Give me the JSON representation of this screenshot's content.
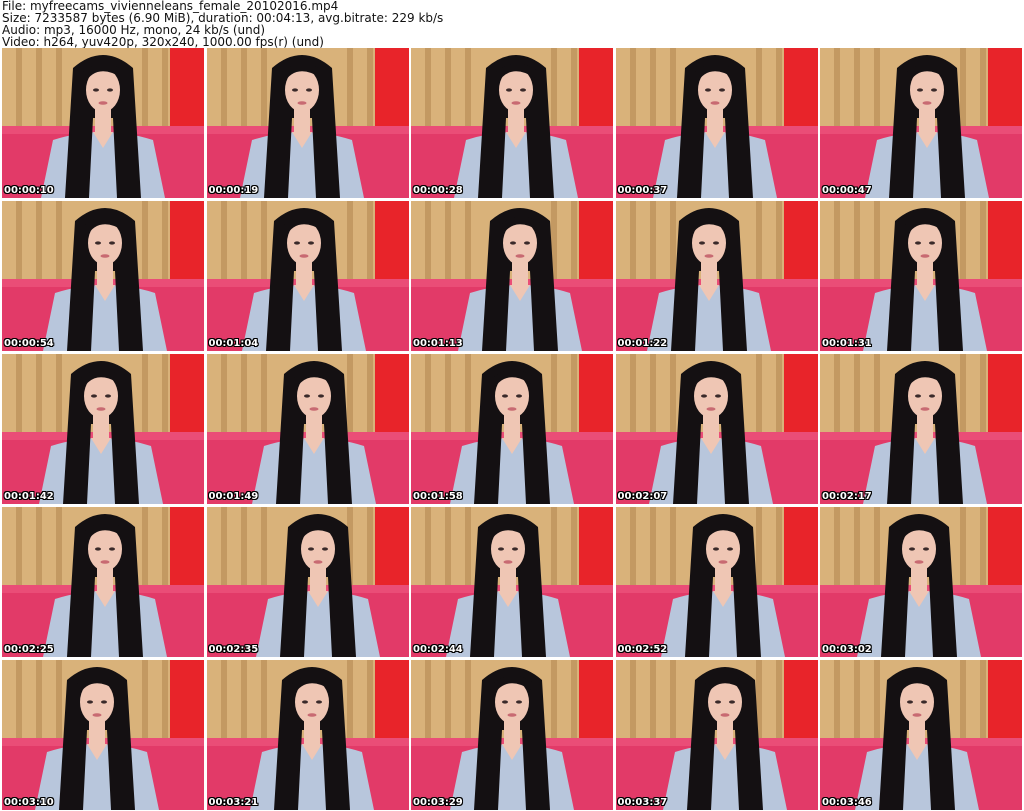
{
  "header": {
    "file": "File: myfreecams_vivienneleans_female_20102016.mp4",
    "size": "Size: 7233587 bytes (6.90 MiB), duration: 00:04:13, avg.bitrate: 229 kb/s",
    "audio": "Audio: mp3, 16000 Hz, mono, 24 kb/s (und)",
    "video": "Video: h264, yuv420p, 320x240, 1000.00 fps(r) (und)"
  },
  "frames": [
    {
      "timestamp": "00:00:10"
    },
    {
      "timestamp": "00:00:19"
    },
    {
      "timestamp": "00:00:28"
    },
    {
      "timestamp": "00:00:37"
    },
    {
      "timestamp": "00:00:47"
    },
    {
      "timestamp": "00:00:54"
    },
    {
      "timestamp": "00:01:04"
    },
    {
      "timestamp": "00:01:13"
    },
    {
      "timestamp": "00:01:22"
    },
    {
      "timestamp": "00:01:31"
    },
    {
      "timestamp": "00:01:42"
    },
    {
      "timestamp": "00:01:49"
    },
    {
      "timestamp": "00:01:58"
    },
    {
      "timestamp": "00:02:07"
    },
    {
      "timestamp": "00:02:17"
    },
    {
      "timestamp": "00:02:25"
    },
    {
      "timestamp": "00:02:35"
    },
    {
      "timestamp": "00:02:44"
    },
    {
      "timestamp": "00:02:52"
    },
    {
      "timestamp": "00:03:02"
    },
    {
      "timestamp": "00:03:10"
    },
    {
      "timestamp": "00:03:21"
    },
    {
      "timestamp": "00:03:29"
    },
    {
      "timestamp": "00:03:37"
    },
    {
      "timestamp": "00:03:46"
    }
  ],
  "colors": {
    "curtain": "#d9b27a",
    "curtain_dark": "#a87a45",
    "wall_red": "#e8242a",
    "bed_pink": "#e23a68",
    "hair": "#141012",
    "skin": "#efc6b4",
    "shirt": "#b8c6dc"
  }
}
